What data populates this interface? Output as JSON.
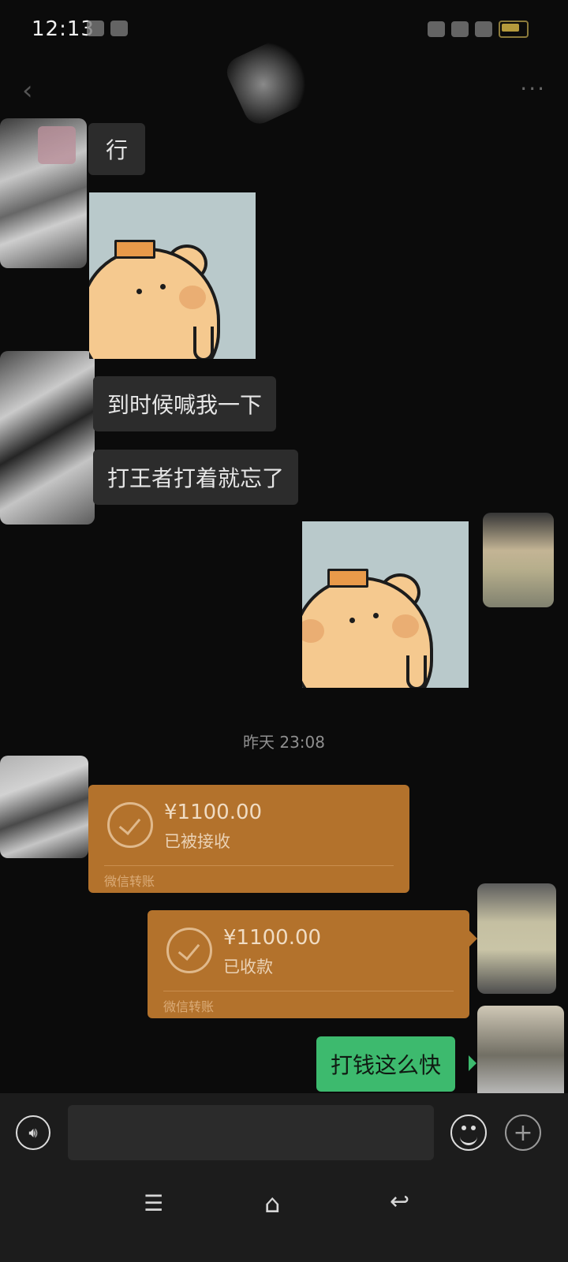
{
  "status_bar": {
    "time": "12:13"
  },
  "header": {
    "back_icon": "chevron-left-icon",
    "more_icon": "more-dots-icon"
  },
  "messages": [
    {
      "side": "left",
      "type": "text",
      "text": "行"
    },
    {
      "side": "left",
      "type": "sticker",
      "sticker": "bear-crown-sticker"
    },
    {
      "side": "left",
      "type": "text",
      "text": "到时候喊我一下"
    },
    {
      "side": "left",
      "type": "text",
      "text": "打王者打着就忘了"
    },
    {
      "side": "right",
      "type": "sticker",
      "sticker": "bear-crown-sticker"
    }
  ],
  "timestamp": "昨天 23:08",
  "transfers": [
    {
      "side": "left",
      "amount": "¥1100.00",
      "status": "已被接收",
      "footer": "微信转账"
    },
    {
      "side": "right",
      "amount": "¥1100.00",
      "status": "已收款",
      "footer": "微信转账"
    }
  ],
  "last_message": {
    "side": "right",
    "type": "text",
    "text": "打钱这么快"
  },
  "colors": {
    "background": "#0b0b0b",
    "incoming_bubble": "#2c2c2c",
    "outgoing_bubble": "#3dba6e",
    "transfer_card": "#b3722c"
  },
  "input_bar": {
    "voice_icon": "voice-icon",
    "emoji_icon": "emoji-icon",
    "plus_icon": "plus-icon",
    "input_value": ""
  },
  "nav_bar": {
    "menu_icon": "menu-icon",
    "home_icon": "home-icon",
    "back_icon": "back-icon"
  }
}
